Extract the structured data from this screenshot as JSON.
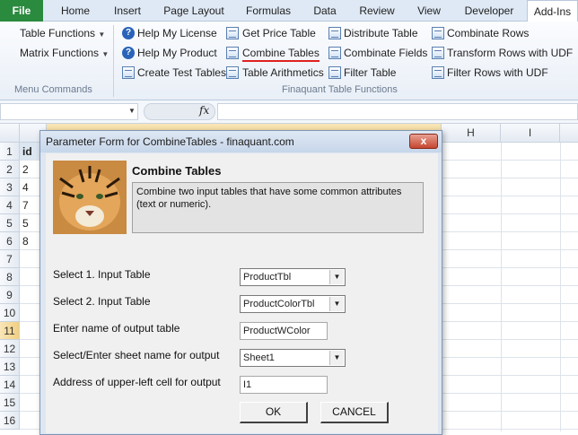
{
  "tabs": [
    "File",
    "Home",
    "Insert",
    "Page Layout",
    "Formulas",
    "Data",
    "Review",
    "View",
    "Developer",
    "Add-Ins"
  ],
  "ribbon": {
    "menu_commands": {
      "items": [
        "Table Functions",
        "Matrix Functions"
      ],
      "group_label": "Menu Commands"
    },
    "finaquant": {
      "col1": [
        "Help My License",
        "Help My Product",
        "Create Test Tables"
      ],
      "col2": [
        "Get Price Table",
        "Combine Tables",
        "Table Arithmetics"
      ],
      "col3": [
        "Distribute Table",
        "Combinate Fields",
        "Filter Table"
      ],
      "col4": [
        "Combinate Rows",
        "Transform Rows with UDF",
        "Filter Rows with UDF"
      ],
      "group_label": "Finaquant Table Functions"
    }
  },
  "formula_bar": {
    "fx": "fx"
  },
  "sheet": {
    "columns_right": [
      "H",
      "I"
    ],
    "rows": [
      "1",
      "2",
      "3",
      "4",
      "5",
      "6",
      "7",
      "8",
      "9",
      "10",
      "11",
      "12",
      "13",
      "14",
      "15",
      "16"
    ],
    "colA": [
      "id",
      "2",
      "4",
      "7",
      "5",
      "8"
    ]
  },
  "dialog": {
    "title": "Parameter Form for CombineTables - finaquant.com",
    "close": "x",
    "heading": "Combine Tables",
    "description": "Combine two input tables that have some common attributes (text or numeric).",
    "fields": [
      {
        "label": "Select 1. Input Table",
        "value": "ProductTbl"
      },
      {
        "label": "Select 2. Input Table",
        "value": "ProductColorTbl"
      },
      {
        "label": "Enter name of output table",
        "value": "ProductWColor"
      },
      {
        "label": "Select/Enter sheet name for output",
        "value": "Sheet1"
      },
      {
        "label": "Address of upper-left cell for output",
        "value": "I1"
      }
    ],
    "ok": "OK",
    "cancel": "CANCEL"
  }
}
